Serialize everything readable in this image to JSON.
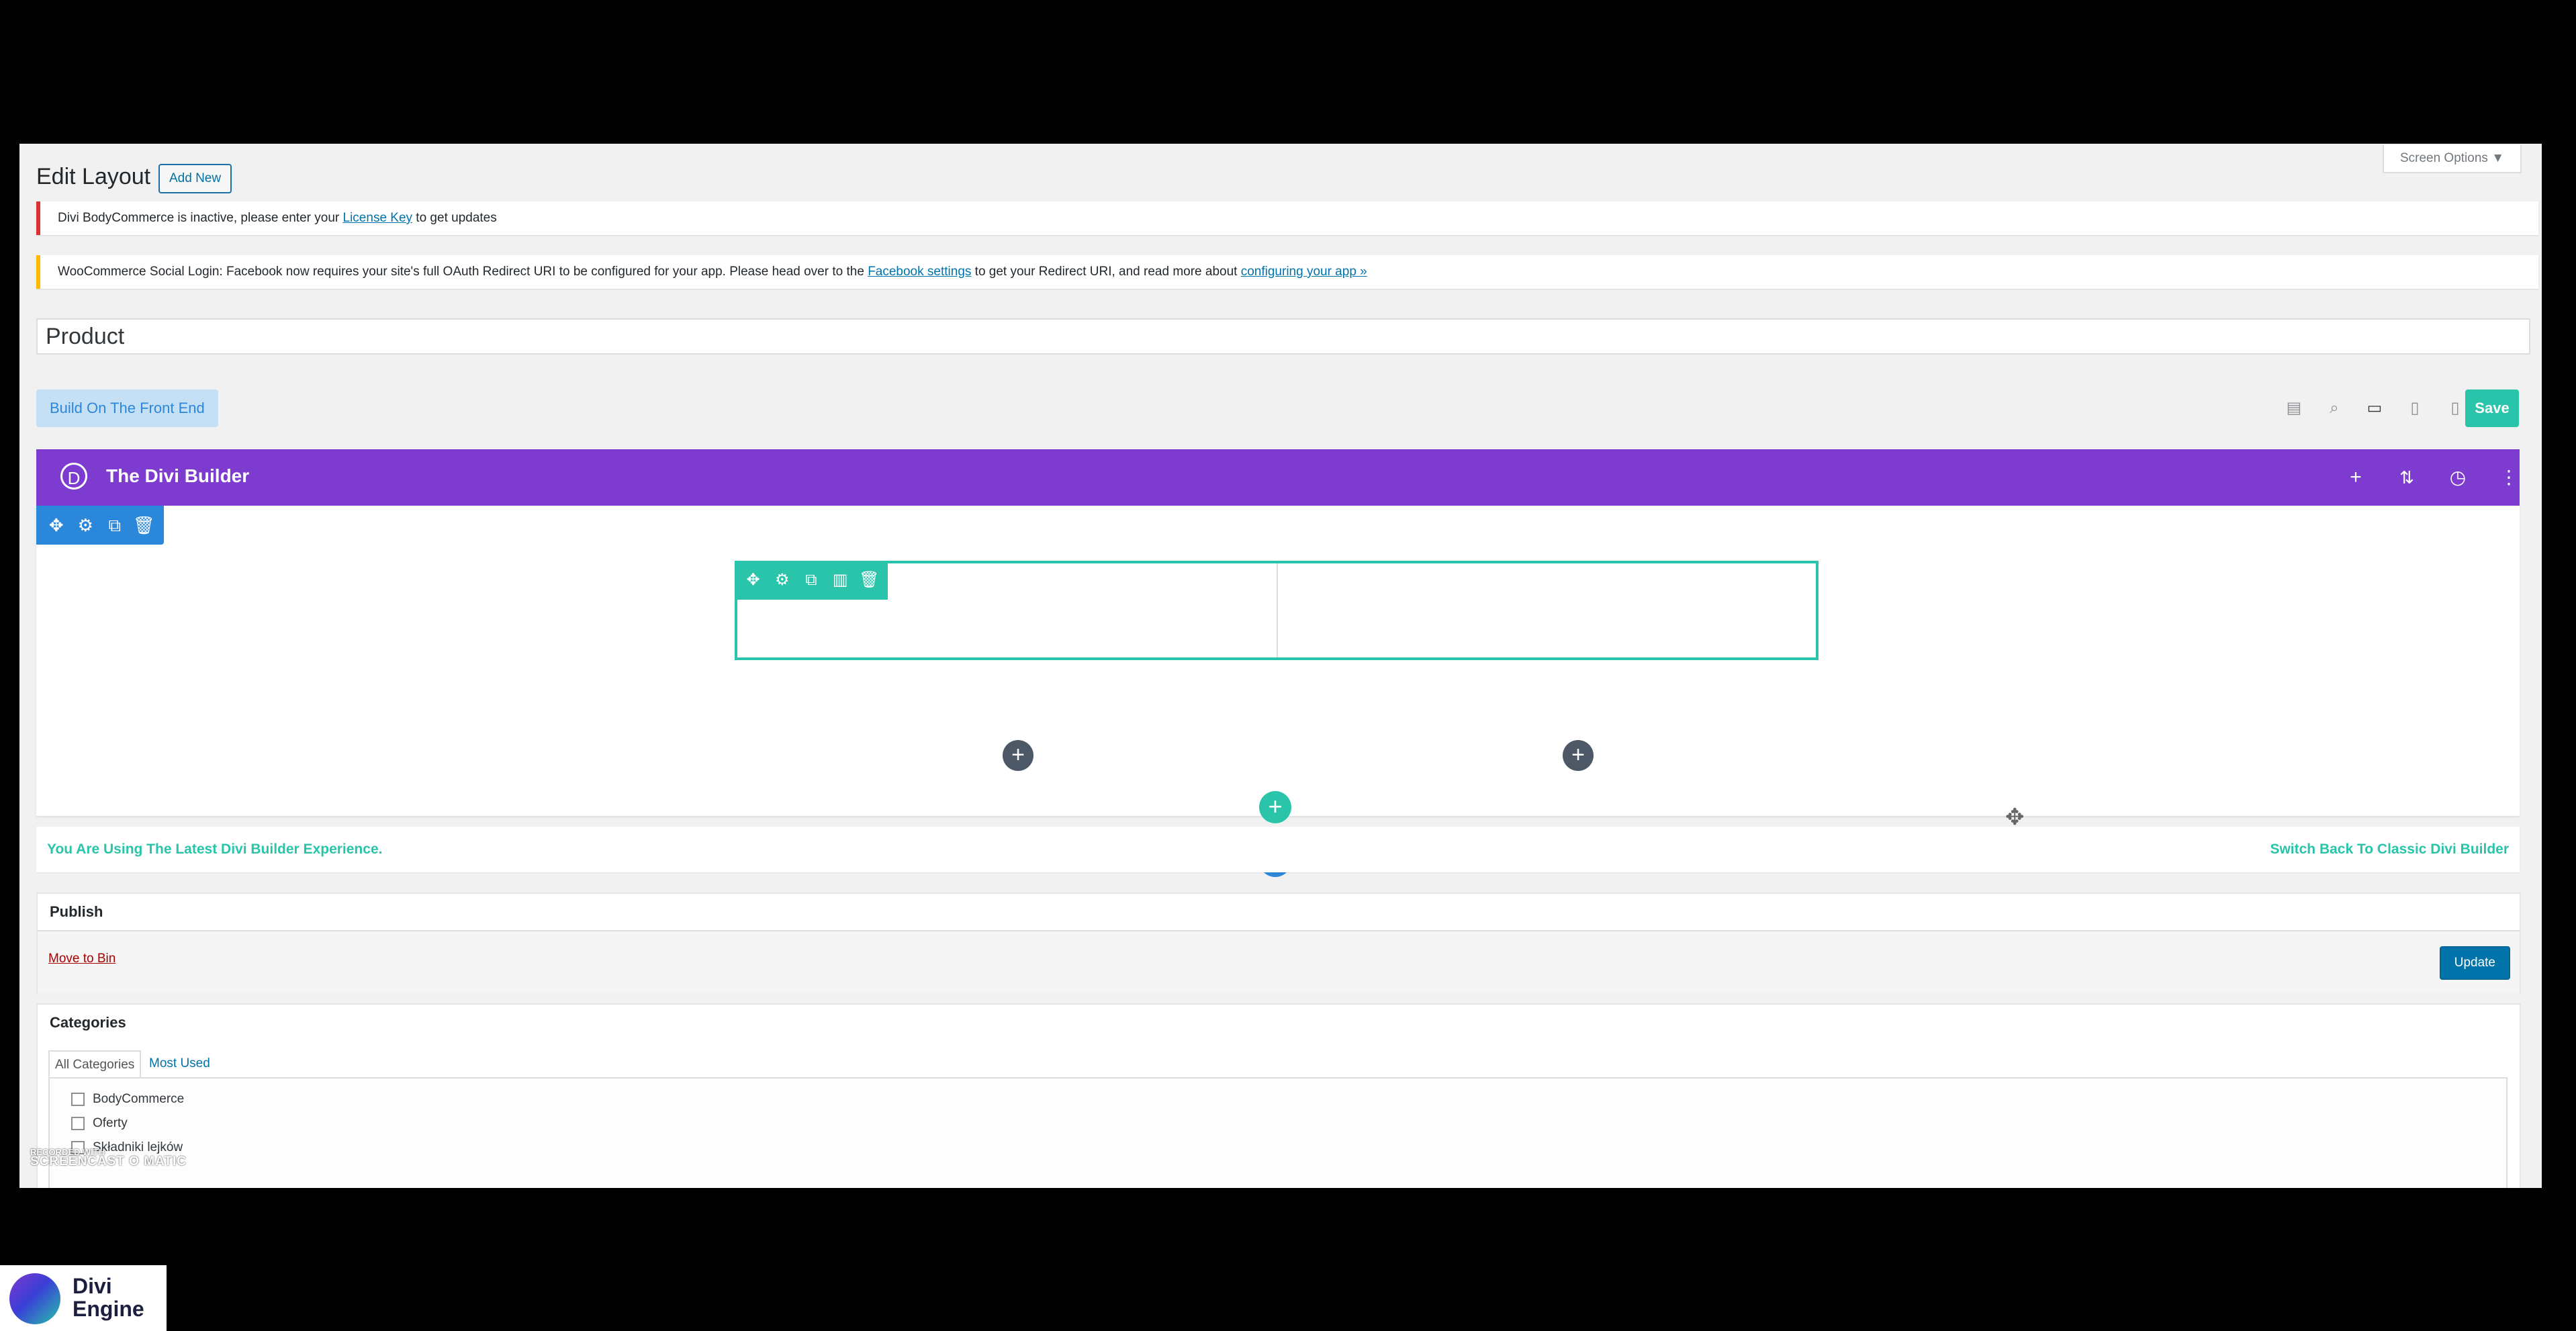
{
  "page": {
    "title": "Edit Layout",
    "add_new": "Add New",
    "screen_options": "Screen Options ▼"
  },
  "notices": {
    "license": {
      "prefix": "Divi BodyCommerce is inactive, please enter your ",
      "link": "License Key",
      "suffix": " to get updates"
    },
    "social": {
      "prefix": "WooCommerce Social Login: Facebook now requires your site's full OAuth Redirect URI to be configured for your app. Please head over to the ",
      "link1": "Facebook settings",
      "middle": " to get your Redirect URI, and read more about ",
      "link2": "configuring your app »"
    }
  },
  "post_title": "Product",
  "toolbar": {
    "front_end": "Build On The Front End",
    "save": "Save"
  },
  "builder": {
    "title": "The Divi Builder",
    "logo": "D"
  },
  "info": {
    "left": "You Are Using The Latest Divi Builder Experience.",
    "right": "Switch Back To Classic Divi Builder"
  },
  "publish": {
    "title": "Publish",
    "move_to_bin": "Move to Bin",
    "update": "Update"
  },
  "categories": {
    "title": "Categories",
    "tab_all": "All Categories",
    "tab_most": "Most Used",
    "items": [
      "BodyCommerce",
      "Oferty",
      "Składniki lejków"
    ]
  },
  "watermark": {
    "line1": "RECORDED WITH",
    "line2": "SCREENCAST O MATIC"
  },
  "brand": {
    "line1": "Divi",
    "line2": "Engine"
  },
  "colors": {
    "divi_purple": "#7e3bd0",
    "divi_teal": "#29c4a9",
    "divi_blue": "#2b87da",
    "wp_blue": "#0073aa"
  }
}
